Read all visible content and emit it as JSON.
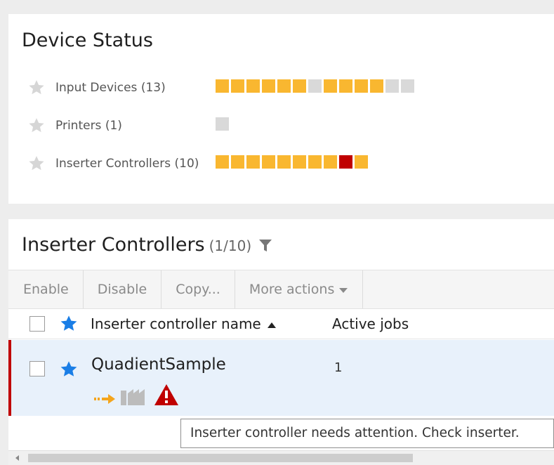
{
  "device_status": {
    "title": "Device Status",
    "rows": [
      {
        "label": "Input Devices (13)",
        "segments": [
          "ok",
          "ok",
          "ok",
          "ok",
          "ok",
          "ok",
          "idle",
          "ok",
          "ok",
          "ok",
          "ok",
          "idle",
          "idle"
        ]
      },
      {
        "label": "Printers (1)",
        "segments": [
          "idle"
        ]
      },
      {
        "label": "Inserter Controllers (10)",
        "segments": [
          "ok",
          "ok",
          "ok",
          "ok",
          "ok",
          "ok",
          "ok",
          "ok",
          "err",
          "ok"
        ]
      }
    ]
  },
  "inserter_controllers": {
    "title": "Inserter Controllers",
    "count": "(1/10)",
    "toolbar": {
      "enable": "Enable",
      "disable": "Disable",
      "copy": "Copy...",
      "more_actions": "More actions"
    },
    "columns": {
      "name": "Inserter controller name",
      "active_jobs": "Active jobs"
    },
    "rows": [
      {
        "name": "QuadientSample",
        "active_jobs": "1"
      }
    ]
  },
  "tooltip": "Inserter controller needs attention. Check inserter.",
  "colors": {
    "status_ok": "#f9b730",
    "status_idle": "#d9d9d9",
    "status_error": "#c00000",
    "selected_row": "#e8f1fb",
    "favorite_star": "#1a7ee6"
  },
  "icons": {
    "row_status": [
      "arrow-in-icon",
      "inserter-machine-icon",
      "warning-icon"
    ]
  }
}
